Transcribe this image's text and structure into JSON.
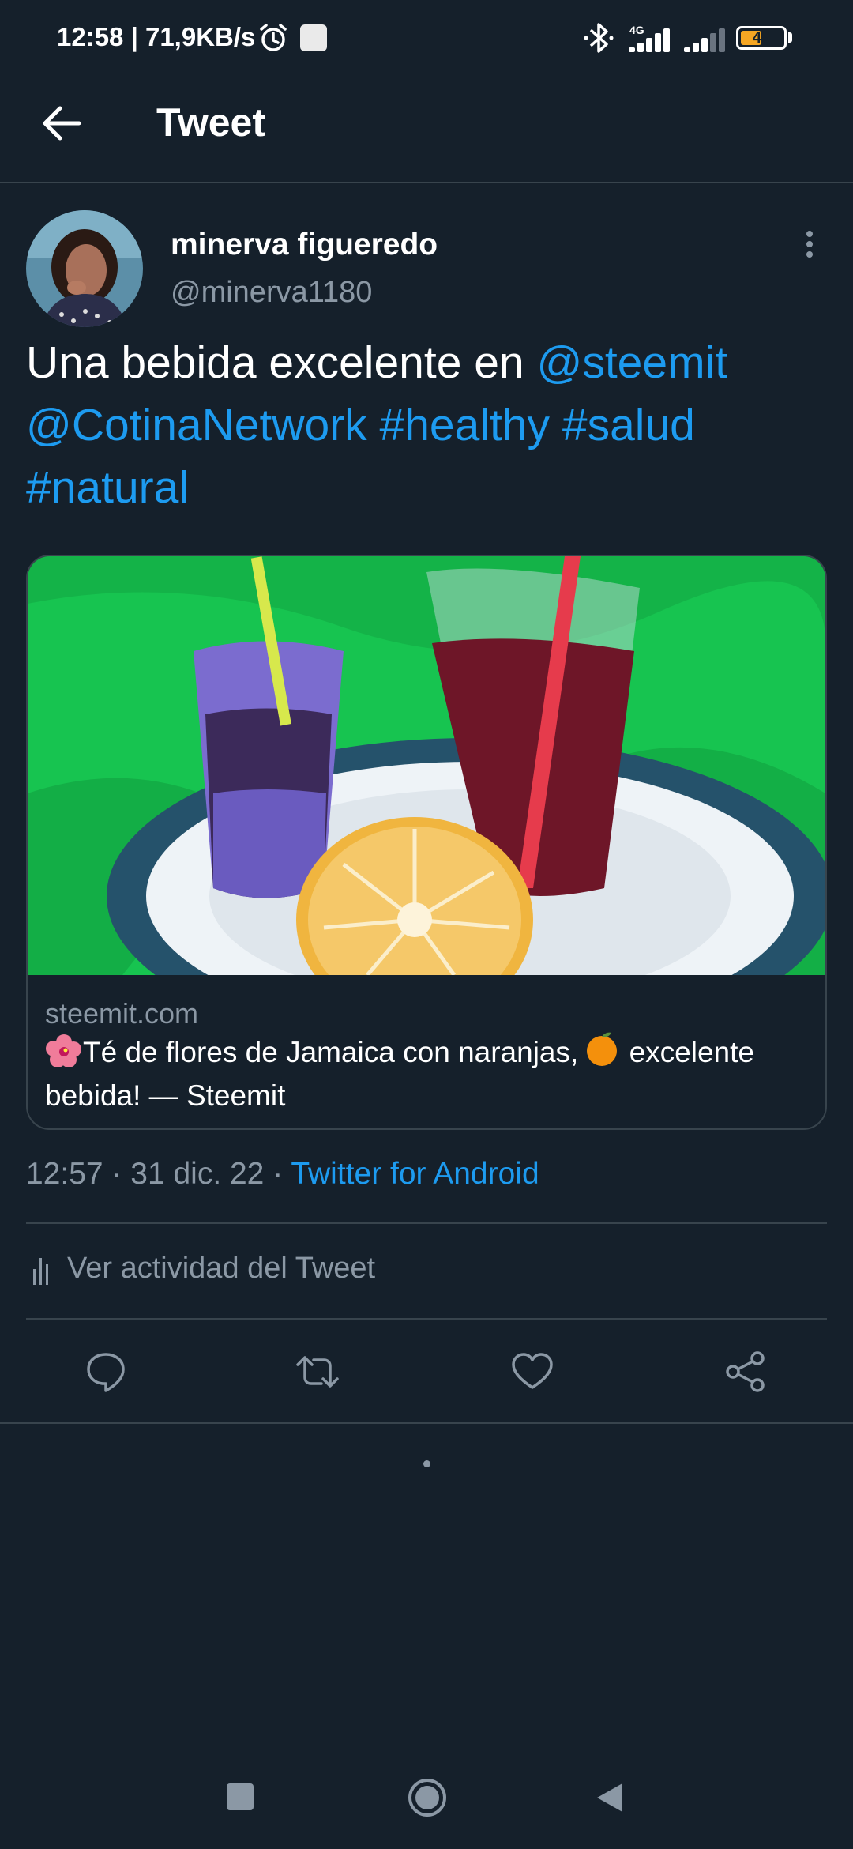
{
  "status_bar": {
    "time": "12:58 | 71,9KB/s",
    "network_label": "4G",
    "battery": "46",
    "icons": [
      "alarm-icon",
      "notification-square-icon",
      "bluetooth-icon",
      "signal-4g-icon",
      "signal-icon",
      "battery-icon"
    ]
  },
  "header": {
    "title": "Tweet",
    "back_icon": "arrow-left-icon"
  },
  "tweet": {
    "author_name": "minerva figueredo",
    "author_handle": "@minerva1180",
    "text_plain": "Una bebida excelente en ",
    "mention_steemit": "@steemit",
    "mention_cotina": "@CotinaNetwork",
    "hashtag_healthy": "#healthy",
    "hashtag_salud": "#salud",
    "hashtag_natural": "#natural",
    "card": {
      "domain": "steemit.com",
      "title_part1": "Té de flores de Jamaica con naranjas,",
      "title_part2": " excelente bebida! — Steemit",
      "emoji_1": "hibiscus-icon",
      "emoji_2": "orange-icon"
    },
    "meta_time": "12:57 · 31 dic. 22 · ",
    "meta_source": "Twitter for Android",
    "activity_label": "Ver actividad del Tweet"
  },
  "actions": [
    "reply-icon",
    "retweet-icon",
    "like-icon",
    "share-icon"
  ],
  "colors": {
    "background": "#15202b",
    "accent": "#1d9bf0",
    "secondary_text": "#8b98a5",
    "divider": "#38444d"
  }
}
